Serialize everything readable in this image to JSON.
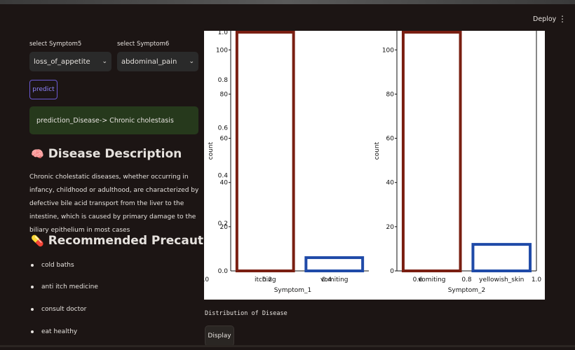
{
  "header": {
    "deploy_label": "Deploy",
    "menu_icon": "kebab-menu-icon"
  },
  "inputs": {
    "symptom5": {
      "label": "select Symptom5",
      "value": "loss_of_appetite"
    },
    "symptom6": {
      "label": "select Symptom6",
      "value": "abdominal_pain"
    }
  },
  "predict_label": "predict",
  "prediction_text": "prediction_Disease-> Chronic cholestasis",
  "description": {
    "heading": "Disease Description",
    "icon": "brain-icon",
    "text": "Chronic cholestatic diseases, whether occurring in infancy, childhood or adulthood, are characterized by defective bile acid transport from the liver to the intestine, which is caused by primary damage to the biliary epithelium in most cases"
  },
  "precautions": {
    "heading": "Recommended Precautions",
    "icon": "pill-icon",
    "items": [
      "cold baths",
      "anti itch medicine",
      "consult doctor",
      "eat healthy"
    ]
  },
  "chart_data": [
    {
      "type": "bar",
      "categories": [
        "itching",
        "vomiting"
      ],
      "values": [
        108,
        6
      ],
      "xlabel": "Symptom_1",
      "ylabel": "count",
      "ylim": [
        0,
        108
      ],
      "colors": [
        "#7a1f12",
        "#1f4aa8"
      ],
      "x_ticks": [
        "0.0",
        "0.2",
        "0.4"
      ],
      "y_ticks_overlay": [
        "0.0",
        "0.2",
        "0.4",
        "0.6",
        "0.8",
        "1.0"
      ],
      "y_ticks": [
        "20",
        "40",
        "60",
        "80",
        "100"
      ]
    },
    {
      "type": "bar",
      "categories": [
        "vomiting",
        "yellowish_skin"
      ],
      "values": [
        108,
        12
      ],
      "xlabel": "Symptom_2",
      "ylabel": "count",
      "ylim": [
        0,
        108
      ],
      "colors": [
        "#7a1f12",
        "#1f4aa8"
      ],
      "x_ticks": [
        "0.6",
        "0.8",
        "1.0"
      ],
      "y_ticks": [
        "0",
        "20",
        "40",
        "60",
        "80",
        "100"
      ]
    }
  ],
  "distribution_label": "Distribution of Disease",
  "display_label": "Display"
}
